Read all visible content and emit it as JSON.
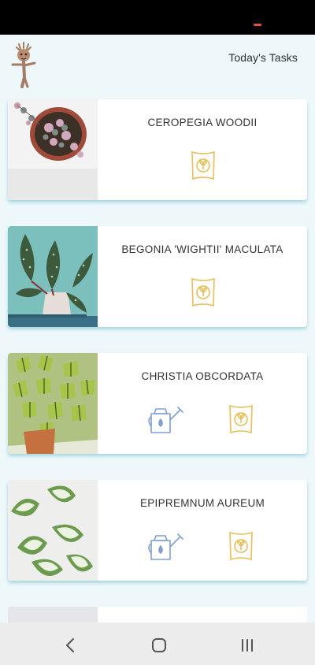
{
  "header": {
    "title": "Today's Tasks",
    "logo_icon": "groot-sprout-icon"
  },
  "plants": [
    {
      "name": "CEROPEGIA WOODII",
      "tasks": [
        "fertilizer"
      ]
    },
    {
      "name": "BEGONIA 'WIGHTII' MACULATA",
      "tasks": [
        "fertilizer"
      ]
    },
    {
      "name": "CHRISTIA OBCORDATA",
      "tasks": [
        "water",
        "fertilizer"
      ]
    },
    {
      "name": "EPIPREMNUM AUREUM",
      "tasks": [
        "water",
        "fertilizer"
      ]
    }
  ],
  "icons": {
    "water": "watering-can-icon",
    "fertilizer": "fertilizer-bag-icon"
  },
  "colors": {
    "water_icon": "#7f9fd6",
    "fertilizer_icon": "#e7bf5a",
    "background": "#eef8fb",
    "card_shadow": "#6ebecd"
  },
  "nav": [
    "back-icon",
    "home-icon",
    "recents-icon"
  ]
}
